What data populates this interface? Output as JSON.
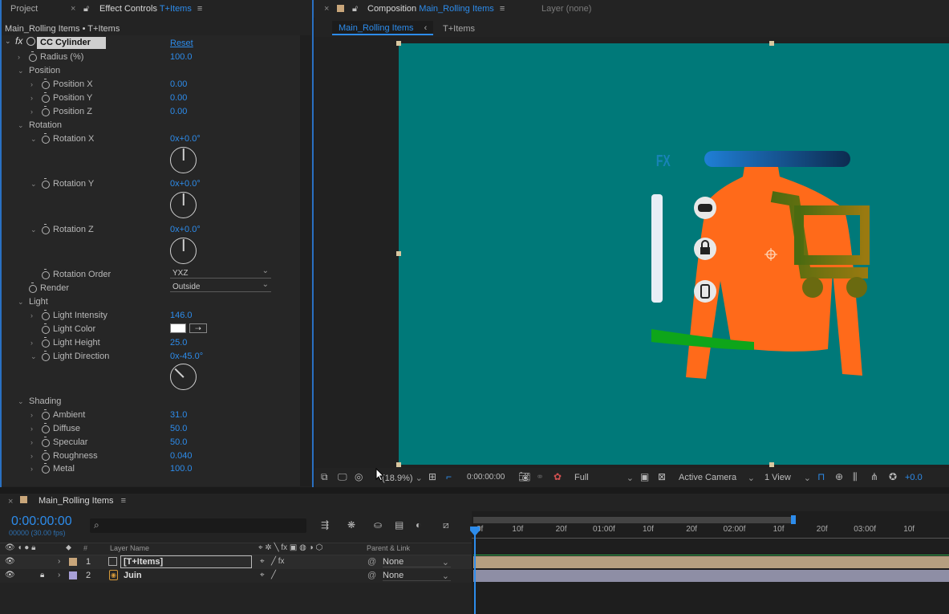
{
  "top_tabs": {
    "project": "Project",
    "effect_controls_prefix": "Effect Controls",
    "effect_controls_layer": "T+Items",
    "composition_prefix": "Composition",
    "composition_name": "Main_Rolling Items",
    "layer": "Layer (none)"
  },
  "effect_controls": {
    "breadcrumb": "Main_Rolling Items • T+Items",
    "effect_name": "CC Cylinder",
    "reset": "Reset",
    "params": {
      "radius": {
        "label": "Radius (%)",
        "value": "100.0"
      },
      "position": {
        "label": "Position"
      },
      "position_x": {
        "label": "Position X",
        "value": "0.00"
      },
      "position_y": {
        "label": "Position Y",
        "value": "0.00"
      },
      "position_z": {
        "label": "Position Z",
        "value": "0.00"
      },
      "rotation": {
        "label": "Rotation"
      },
      "rotation_x": {
        "label": "Rotation X",
        "value": "0x+0.0°",
        "angle": 0
      },
      "rotation_y": {
        "label": "Rotation Y",
        "value": "0x+0.0°",
        "angle": 0
      },
      "rotation_z": {
        "label": "Rotation Z",
        "value": "0x+0.0°",
        "angle": 0
      },
      "rotation_order": {
        "label": "Rotation Order",
        "value": "YXZ"
      },
      "render": {
        "label": "Render",
        "value": "Outside"
      },
      "light": {
        "label": "Light"
      },
      "light_intensity": {
        "label": "Light Intensity",
        "value": "146.0"
      },
      "light_color": {
        "label": "Light Color",
        "color": "#ffffff"
      },
      "light_height": {
        "label": "Light Height",
        "value": "25.0"
      },
      "light_direction": {
        "label": "Light Direction",
        "value": "0x-45.0°",
        "angle": -45
      },
      "shading": {
        "label": "Shading"
      },
      "ambient": {
        "label": "Ambient",
        "value": "31.0"
      },
      "diffuse": {
        "label": "Diffuse",
        "value": "50.0"
      },
      "specular": {
        "label": "Specular",
        "value": "50.0"
      },
      "roughness": {
        "label": "Roughness",
        "value": "0.040"
      },
      "metal": {
        "label": "Metal",
        "value": "100.0"
      }
    }
  },
  "composition": {
    "sub_tab_active": "Main_Rolling Items",
    "sub_tab_other": "T+Items",
    "canvas_color": "#007979",
    "fx_text": "FX",
    "viewer_bar": {
      "zoom": "(18.9%)",
      "timecode": "0:00:00:00",
      "resolution": "Full",
      "camera": "Active Camera",
      "views": "1 View",
      "exposure": "+0.0"
    }
  },
  "timeline": {
    "comp_name": "Main_Rolling Items",
    "timecode": "0:00:00:00",
    "frame_info": "00000 (30.00 fps)",
    "search_placeholder": "",
    "columns": {
      "layer_name": "Layer Name",
      "parent": "Parent & Link",
      "hash": "#"
    },
    "ruler": [
      "0f",
      "10f",
      "20f",
      "01:00f",
      "10f",
      "20f",
      "02:00f",
      "10f",
      "20f",
      "03:00f",
      "10f"
    ],
    "layers": [
      {
        "num": "1",
        "name": "[T+Items]",
        "parent": "None",
        "color": "#c9a67a",
        "bar_color": "#b59f80"
      },
      {
        "num": "2",
        "name": "Juin",
        "parent": "None",
        "color": "#a8a0d8",
        "bar_color": "#8e8ea5"
      }
    ]
  }
}
